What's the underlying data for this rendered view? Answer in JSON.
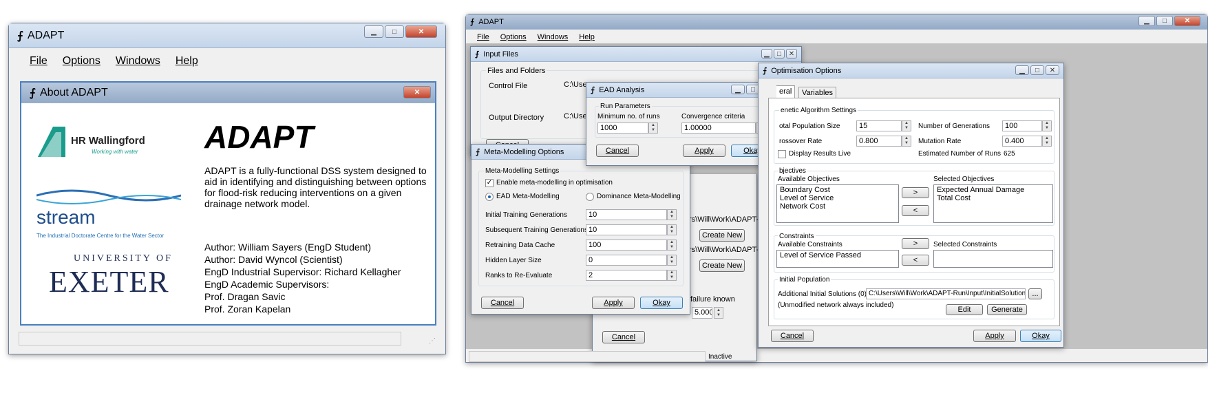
{
  "left": {
    "title": "ADAPT",
    "menu": [
      "File",
      "Options",
      "Windows",
      "Help"
    ],
    "about": {
      "title": "About ADAPT",
      "heading": "ADAPT",
      "description": "ADAPT is a fully-functional DSS system designed to aid in identifying and distinguishing between options for flood-risk reducing interventions on a given drainage network model.",
      "authors": [
        "Author: William Sayers (EngD Student)",
        "Author: David Wyncol (Scientist)",
        "EngD Industrial Supervisor: Richard Kellagher",
        "EngD Academic Supervisors:",
        "Prof. Dragan Savic",
        "Prof. Zoran Kapelan"
      ],
      "logos": {
        "hr_name": "HR Wallingford",
        "hr_tag": "Working with water",
        "stream_name": "stream",
        "stream_tag": "The Industrial Doctorate Centre for the Water Sector",
        "exeter_top": "UNIVERSITY OF",
        "exeter_name": "EXETER"
      }
    }
  },
  "right": {
    "title": "ADAPT",
    "menu": [
      "File",
      "Options",
      "Windows",
      "Help"
    ],
    "status": "Inactive",
    "input_files": {
      "title": "Input Files",
      "group": "Files and Folders",
      "control_label": "Control File",
      "control_value": "C:\\User",
      "output_label": "Output Directory",
      "output_value": "C:\\Use",
      "cancel": "Cancel"
    },
    "ead": {
      "title": "EAD Analysis",
      "group": "Run Parameters",
      "min_runs_label": "Minimum no. of runs",
      "min_runs": "1000",
      "conv_label": "Convergence criteria",
      "conv": "1.00000",
      "cancel": "Cancel",
      "apply": "Apply",
      "okay": "Okay"
    },
    "meta": {
      "title": "Meta-Modelling Options",
      "group": "Meta-Modelling Settings",
      "enable": "Enable meta-modelling in optimisation",
      "radio_ead": "EAD Meta-Modelling",
      "radio_dom": "Dominance Meta-Modelling",
      "rows": [
        {
          "label": "Initial Training Generations",
          "value": "10"
        },
        {
          "label": "Subsequent Training Generations",
          "value": "10"
        },
        {
          "label": "Retraining Data Cache",
          "value": "100"
        },
        {
          "label": "Hidden Layer Size",
          "value": "0"
        },
        {
          "label": "Ranks to Re-Evaluate",
          "value": "2"
        }
      ],
      "cancel": "Cancel",
      "apply": "Apply",
      "okay": "Okay"
    },
    "hidden": {
      "path1": "rs\\Will\\Work\\ADAPT-F",
      "path2": "rs\\Will\\Work\\ADAPT-F",
      "create_new": "Create New",
      "failure_known": "failure known",
      "failure_value": "5.000",
      "cancel": "Cancel"
    },
    "opt": {
      "title": "Optimisation Options",
      "tabs": [
        "eral",
        "Variables"
      ],
      "ga_group": "enetic Algorithm Settings",
      "pop_label": "otal Population Size",
      "pop": "15",
      "gen_label": "Number of Generations",
      "gen": "100",
      "cross_label": "rossover Rate",
      "cross": "0.800",
      "mut_label": "Mutation Rate",
      "mut": "0.400",
      "display_live": "Display Results Live",
      "est_label": "Estimated Number of Runs",
      "est": "625",
      "obj_group": "bjectives",
      "avail_obj_label": "Available Objectives",
      "avail_obj": [
        "Boundary Cost",
        "Level of Service",
        "Network Cost"
      ],
      "sel_obj_label": "Selected Objectives",
      "sel_obj": [
        "Expected Annual Damage",
        "Total Cost"
      ],
      "con_group": "Constraints",
      "avail_con_label": "Available Constraints",
      "avail_con": [
        "Level of Service Passed"
      ],
      "sel_con_label": "Selected Constraints",
      "init_group": "Initial Population",
      "add_label": "Additional Initial Solutions (0)",
      "path": "C:\\Users\\Will\\Work\\ADAPT-Run\\Input\\InitialSolutions.c",
      "unmod": "(Unmodified network always included)",
      "browse": "...",
      "edit": "Edit",
      "generate": "Generate",
      "move_right": ">",
      "move_left": "<",
      "cancel": "Cancel",
      "apply": "Apply",
      "okay": "Okay"
    }
  }
}
